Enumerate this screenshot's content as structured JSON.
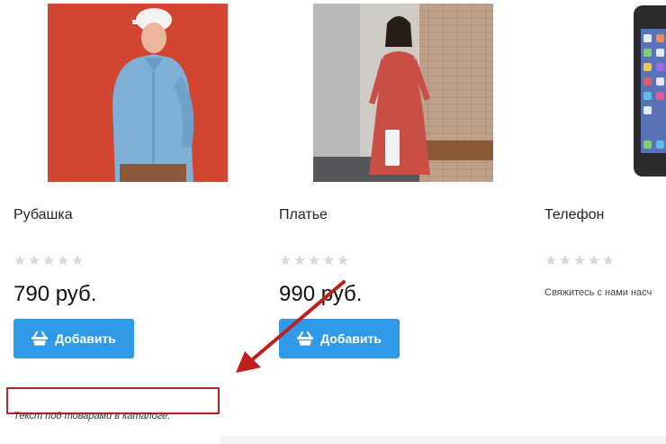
{
  "products": [
    {
      "title": "Рубашка",
      "rating": 0,
      "max_rating": 5,
      "price": "790 руб.",
      "button": "Добавить"
    },
    {
      "title": "Платье",
      "rating": 0,
      "max_rating": 5,
      "price": "990 руб.",
      "button": "Добавить"
    },
    {
      "title": "Телефон",
      "rating": 0,
      "max_rating": 5,
      "contact": "Свяжитесь с нами насч"
    }
  ],
  "catalog_text": "Текст под товарами в каталоге.",
  "colors": {
    "button": "#2f9aea",
    "annotation": "#bf1f1f",
    "star_empty": "#d9d9d9"
  }
}
